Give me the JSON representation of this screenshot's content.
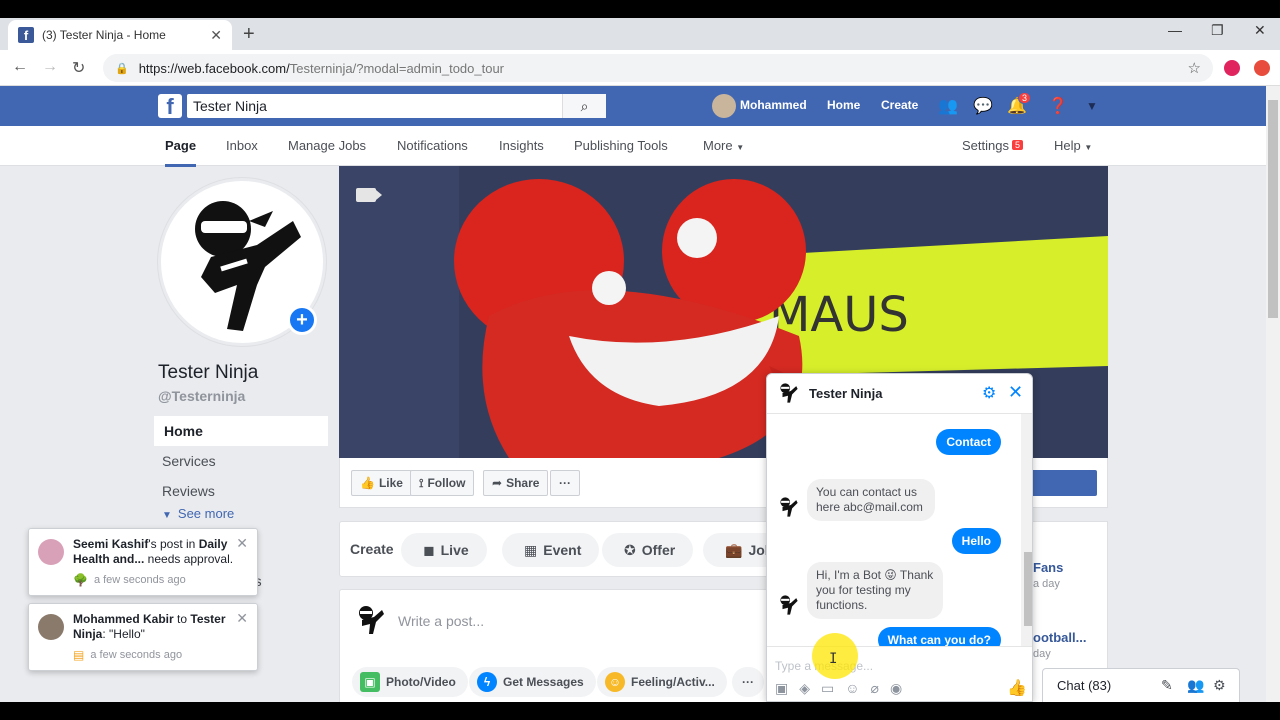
{
  "browser": {
    "tab_title": "(3) Tester Ninja - Home",
    "url_main": "https://web.facebook.com/",
    "url_rest": "Testerninja/?modal=admin_todo_tour"
  },
  "fb": {
    "search_value": "Tester Ninja",
    "user_name": "Mohammed",
    "nav_home": "Home",
    "nav_create": "Create",
    "notif_count": "3"
  },
  "page_tabs": {
    "page": "Page",
    "inbox": "Inbox",
    "manage_jobs": "Manage Jobs",
    "notifications": "Notifications",
    "insights": "Insights",
    "publishing_tools": "Publishing Tools",
    "more": "More",
    "settings": "Settings",
    "settings_badge": "5",
    "help": "Help"
  },
  "profile": {
    "name": "Tester Ninja",
    "handle": "@Testerninja",
    "nav": [
      "Home",
      "Services",
      "Reviews"
    ],
    "see_more": "See more",
    "partial_text": "ons"
  },
  "popups": [
    {
      "user": "Seemi Kashif",
      "text_a": "'s post in ",
      "group": "Daily Health and...",
      "text_b": " needs approval.",
      "time": "a few seconds ago"
    },
    {
      "user": "Mohammed Kabir",
      "text_a": " to ",
      "group": "Tester Ninja",
      "text_b": ": \"Hello\"",
      "time": "a few seconds ago"
    }
  ],
  "cover": {
    "sign_text": "MAUS"
  },
  "cover_actions": {
    "like": "Like",
    "follow": "Follow",
    "share": "Share",
    "more": "···"
  },
  "create": {
    "label": "Create",
    "live": "Live",
    "event": "Event",
    "offer": "Offer",
    "job": "Job"
  },
  "composer": {
    "placeholder": "Write a post...",
    "photo_video": "Photo/Video",
    "get_messages": "Get Messages",
    "feeling": "Feeling/Activ...",
    "more": "···"
  },
  "right_col": {
    "link1": "Fans",
    "sub1": "a day",
    "link2": "ootball...",
    "sub2": "day"
  },
  "chat": {
    "label": "Chat (83)"
  },
  "messenger": {
    "title": "Tester Ninja",
    "msg_contact": "Contact",
    "msg_contact_reply": "You can contact us here abc@mail.com",
    "msg_hello": "Hello",
    "msg_bot_reply": "Hi, I'm a Bot 😜 Thank you for testing my functions.",
    "msg_what": "What can you do?",
    "input_placeholder": "Type a message..."
  }
}
